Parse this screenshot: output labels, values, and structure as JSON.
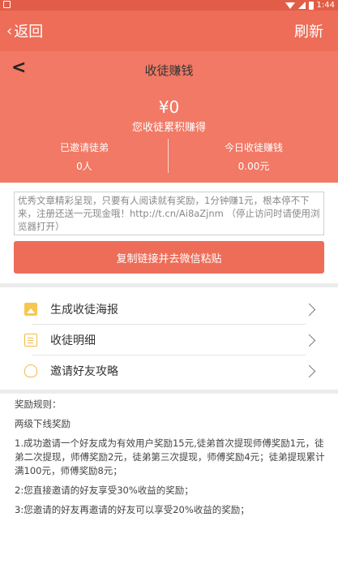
{
  "status_bar": {
    "time": "1:44"
  },
  "app_bar": {
    "back_label": "返回",
    "refresh_label": "刷新"
  },
  "page": {
    "title": "收徒赚钱",
    "amount": "¥0",
    "amount_label": "您收徒累积赚得",
    "stats": [
      {
        "label": "已邀请徒弟",
        "value": "0人"
      },
      {
        "label": "今日收徒赚钱",
        "value": "0.00元"
      }
    ]
  },
  "share": {
    "text": "优秀文章精彩呈现，只要有人阅读就有奖励，1分钟赚1元，根本停不下来，注册还送一元现金哦！http://t.cn/Ai8aZjnm （停止访问时请使用浏览器打开）",
    "copy_button": "复制链接并去微信粘贴"
  },
  "menu": [
    {
      "label": "生成收徒海报",
      "icon": "image-icon"
    },
    {
      "label": "收徒明细",
      "icon": "document-icon"
    },
    {
      "label": "邀请好友攻略",
      "icon": "lightbulb-icon"
    }
  ],
  "rules": {
    "heading": "奖励规则：",
    "subheading": "两级下线奖励",
    "items": [
      "1.成功邀请一个好友成为有效用户奖励15元,徒弟首次提现师傅奖励1元，徒弟二次提现，师傅奖励2元，徒弟第三次提现，师傅奖励4元；徒弟提现累计满100元，师傅奖励8元；",
      "2:您直接邀请的好友享受30%收益的奖励；",
      "3:您邀请的好友再邀请的好友可以享受20%收益的奖励；"
    ]
  },
  "colors": {
    "primary": "#ed6d58",
    "hero": "#f17965",
    "accent_icon": "#f3b94a"
  }
}
